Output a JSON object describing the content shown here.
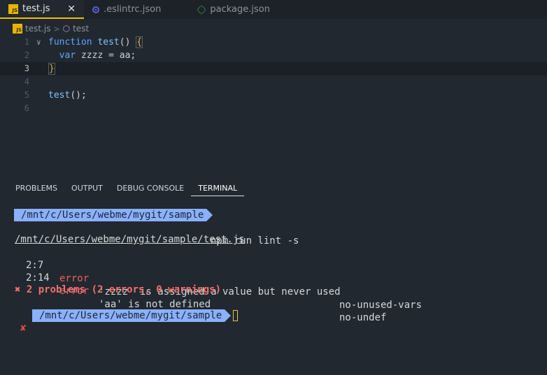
{
  "tabs": [
    {
      "label": "test.js",
      "icon": "js-file-icon",
      "active": true
    },
    {
      "label": ".eslintrc.json",
      "icon": "eslint-icon",
      "active": false
    },
    {
      "label": "package.json",
      "icon": "node-icon",
      "active": false
    }
  ],
  "tab_close_glyph": "✕",
  "breadcrumb": {
    "file": "test.js",
    "separator": ">",
    "symbol": "test"
  },
  "editor": {
    "lines": [
      {
        "n": "1",
        "fold": "∨",
        "parts": [
          {
            "t": "function ",
            "c": "kw"
          },
          {
            "t": "test",
            "c": "fn"
          },
          {
            "t": "() ",
            "c": ""
          },
          {
            "t": "{",
            "c": "brace"
          }
        ]
      },
      {
        "n": "2",
        "parts": [
          {
            "t": "  ",
            "c": ""
          },
          {
            "t": "var ",
            "c": "kw"
          },
          {
            "t": "zzzz = aa;",
            "c": ""
          }
        ]
      },
      {
        "n": "3",
        "current": true,
        "parts": [
          {
            "t": "}",
            "c": "brace"
          }
        ]
      },
      {
        "n": "4",
        "parts": []
      },
      {
        "n": "5",
        "parts": [
          {
            "t": "test",
            "c": "fn"
          },
          {
            "t": "();",
            "c": ""
          }
        ]
      },
      {
        "n": "6",
        "parts": []
      }
    ]
  },
  "panel": {
    "tabs": [
      "PROBLEMS",
      "OUTPUT",
      "DEBUG CONSOLE",
      "TERMINAL"
    ],
    "active_tab": "TERMINAL"
  },
  "terminal": {
    "prompt_path": "/mnt/c/Users/webme/mygit/sample",
    "command": "npm run lint -s",
    "file_path": "/mnt/c/Users/webme/mygit/sample/test.js",
    "problems": [
      {
        "loc": "2:7",
        "severity": "error",
        "message": "'zzzz' is assigned a value but never used",
        "rule": "no-unused-vars"
      },
      {
        "loc": "2:14",
        "severity": "error",
        "message": "'aa' is not defined",
        "rule": "no-undef"
      }
    ],
    "summary": "✖ 2 problems (2 errors, 0 warnings)",
    "fail_mark": "✘",
    "prompt_path_2": "/mnt/c/Users/webme/mygit/sample"
  },
  "colors": {
    "background": "#22282f",
    "prompt_bg": "#8ab0ff",
    "error": "#e86060",
    "active_tab_border": "#f0c000"
  }
}
